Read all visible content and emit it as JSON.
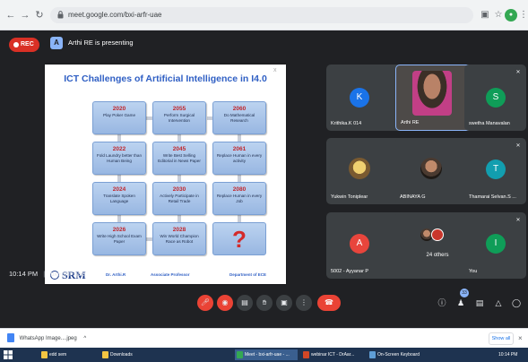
{
  "browser": {
    "url": "meet.google.com/bxi-arfr-uae",
    "icons": [
      "back-icon",
      "forward-icon",
      "reload-icon",
      "lock-icon",
      "extension-icon",
      "star-icon",
      "profile-icon",
      "menu-icon"
    ]
  },
  "meet": {
    "rec_label": "REC",
    "presenter_initial": "A",
    "presenting_text": "Arthi RE is presenting",
    "time": "10:14 PM",
    "separator": "|",
    "meeting_code": "bxi-arfr-uae",
    "participant_count": "33"
  },
  "slide": {
    "title": "ICT Challenges of Artificial Intelligence in I4.0",
    "close_mark": "x",
    "cards": [
      {
        "year": "2020",
        "text": "Play Poker Game"
      },
      {
        "year": "2055",
        "text": "Perform Surgical Intervention"
      },
      {
        "year": "2060",
        "text": "Do Mathematical Research"
      },
      {
        "year": "2022",
        "text": "Fold Laundry better than Human Being"
      },
      {
        "year": "2045",
        "text": "Write Best Selling Editorial in News Paper"
      },
      {
        "year": "2061",
        "text": "Replace Human in every activity"
      },
      {
        "year": "2024",
        "text": "Translate Spoken Language"
      },
      {
        "year": "2030",
        "text": "Actively Participate in Retail Trade"
      },
      {
        "year": "2080",
        "text": "Replace Human in every Job"
      },
      {
        "year": "2026",
        "text": "Write High School Exam Paper"
      },
      {
        "year": "2028",
        "text": "Win World Champion Race as Robot"
      }
    ],
    "question_mark": "?",
    "logo": "SRM",
    "footer_name": "Dr. Arthi.R",
    "footer_role": "Associate Professor",
    "footer_dept": "Department of ECE"
  },
  "participants": [
    {
      "name": "Krithika.K 014",
      "initial": "K",
      "color": "#1a73e8"
    },
    {
      "name": "Arthi RE",
      "initial": "",
      "color": ""
    },
    {
      "name": "swetha Manavalan",
      "initial": "S",
      "color": "#0f9d58"
    },
    {
      "name": "Yukwin Toniplear",
      "initial": "",
      "color": ""
    },
    {
      "name": "ABINAYA G",
      "initial": "",
      "color": ""
    },
    {
      "name": "Thamarai Selvan.S ...",
      "initial": "T",
      "color": "#129eaf"
    },
    {
      "name": "5002 - Ayyanar P",
      "initial": "A",
      "color": "#e8453c"
    },
    {
      "name": "24 others",
      "initial": "",
      "color": ""
    },
    {
      "name": "You",
      "initial": "I",
      "color": "#0f9d58"
    }
  ],
  "downloads": {
    "file": "WhatsApp Image....jpeg",
    "chevron": "^",
    "show_all": "Show all",
    "close": "×"
  },
  "taskbar": {
    "items": [
      "edd sem",
      "Downloads",
      "Meet - bxi-arfr-uae - ...",
      "webinar ICT - DrAar...",
      "On-Screen Keyboard"
    ],
    "clock": "10:14 PM"
  },
  "colors": {
    "meet_bg": "#202124",
    "tile_bg": "#3c4043",
    "rec_red": "#d93025",
    "end_call_red": "#ea4335",
    "slide_title_blue": "#2f5fc4",
    "taskbar_bg": "#1e3350"
  }
}
